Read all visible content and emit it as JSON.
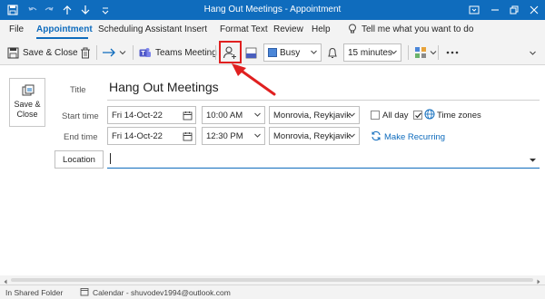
{
  "window": {
    "title": "Hang Out Meetings  -  Appointment"
  },
  "menu": {
    "tabs": [
      "File",
      "Appointment",
      "Scheduling Assistant",
      "Insert",
      "Format Text",
      "Review",
      "Help"
    ],
    "active_tab": "Appointment",
    "search_placeholder": "Tell me what you want to do"
  },
  "toolbar": {
    "save_close": "Save & Close",
    "teams_meeting": "Teams Meeting",
    "show_as": "Busy",
    "reminder": "15 minutes"
  },
  "form": {
    "save_close_card": "Save & Close",
    "title_label": "Title",
    "title_value": "Hang Out Meetings",
    "start_label": "Start time",
    "start_date": "Fri 14-Oct-22",
    "start_time": "10:00 AM",
    "start_tz": "Monrovia, Reykjavik",
    "all_day": "All day",
    "time_zones": "Time zones",
    "end_label": "End time",
    "end_date": "Fri 14-Oct-22",
    "end_time": "12:30 PM",
    "end_tz": "Monrovia, Reykjavik",
    "make_recurring": "Make Recurring",
    "location_button": "Location",
    "location_value": ""
  },
  "status": {
    "left": "In Shared Folder",
    "calendar": "Calendar - shuvodev1994@outlook.com"
  },
  "colors": {
    "accent": "#0f6cbd",
    "highlight": "#e02020"
  }
}
